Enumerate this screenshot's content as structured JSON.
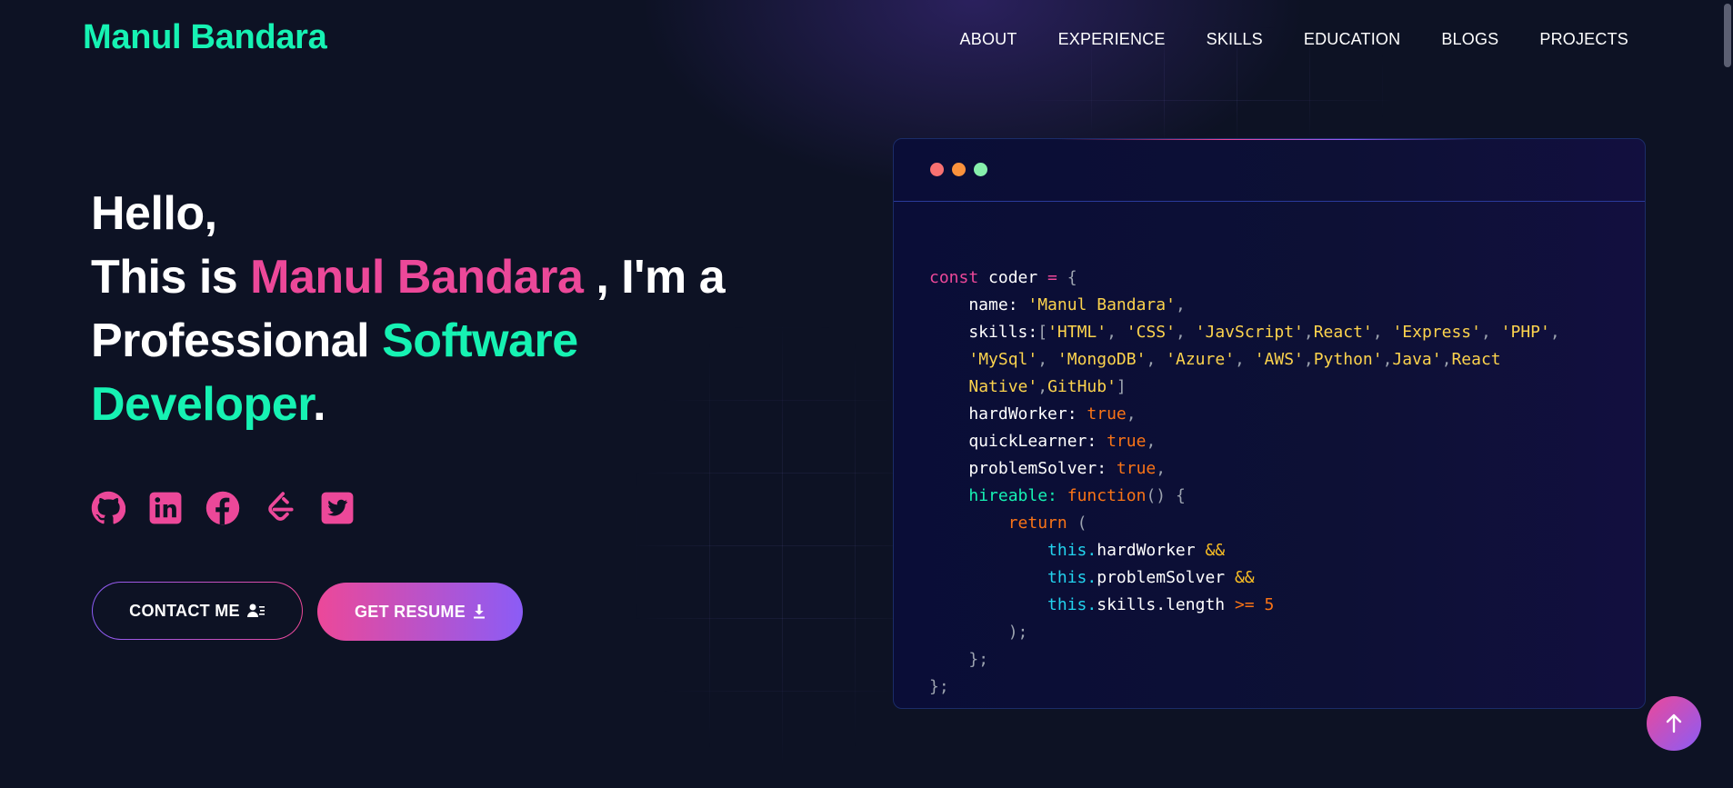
{
  "header": {
    "brand": "Manul Bandara",
    "nav": [
      "ABOUT",
      "EXPERIENCE",
      "SKILLS",
      "EDUCATION",
      "BLOGS",
      "PROJECTS"
    ]
  },
  "hero": {
    "greeting": "Hello,",
    "this_is": "This is ",
    "name": "Manul Bandara",
    "im_a": " , I'm a",
    "professional": "Professional ",
    "software": "Software",
    "developer": "Developer",
    "period": "."
  },
  "socials": [
    "github-icon",
    "linkedin-icon",
    "facebook-icon",
    "leetcode-icon",
    "twitter-icon"
  ],
  "buttons": {
    "contact": "CONTACT ME",
    "resume": "GET RESUME"
  },
  "code_window": {
    "dots": [
      "#f87171",
      "#fb923c",
      "#86efac"
    ],
    "lines": [
      "const coder = {",
      "name: 'Manul Bandara',",
      "skills:['HTML', 'CSS', 'JavScript',React', 'Express', 'PHP',",
      "'MySql', 'MongoDB', 'Azure', 'AWS',Python',Java',React",
      "Native',GitHub']",
      "hardWorker: true,",
      "quickLearner: true,",
      "problemSolver: true,",
      "hireable: function() {",
      "return (",
      "this.hardWorker &&",
      "this.problemSolver &&",
      "this.skills.length >= 5",
      ");",
      "};",
      "};"
    ]
  },
  "colors": {
    "background": "#0d1224",
    "accent_green": "#16f2b3",
    "accent_pink": "#ec4899",
    "accent_purple": "#8b5cf6"
  }
}
